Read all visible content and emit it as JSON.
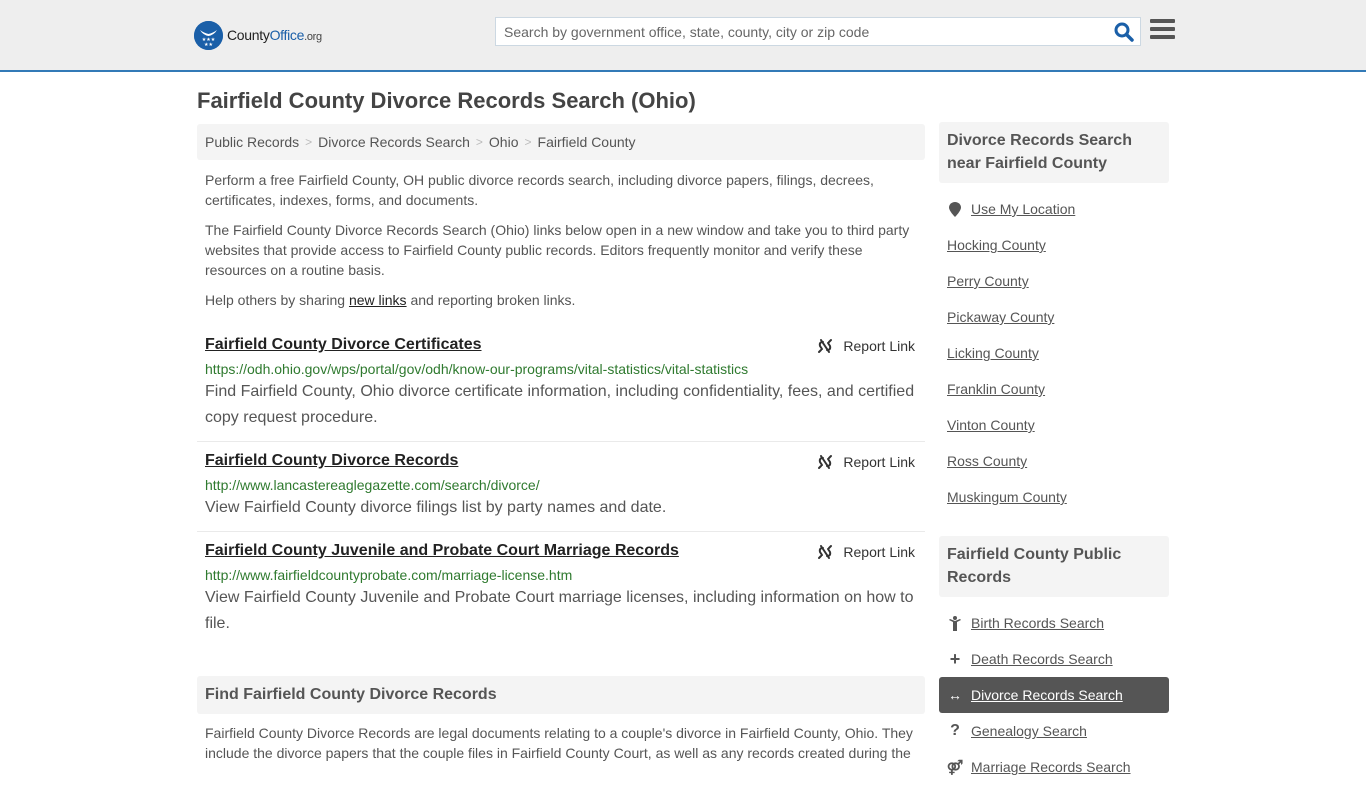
{
  "header": {
    "logo": {
      "name_part1": "County",
      "name_part2": "Office",
      "tld": ".org",
      "emblem": "eagle-stars-emblem"
    },
    "search": {
      "placeholder": "Search by government office, state, county, city or zip code",
      "value": "",
      "icon": "search-icon"
    },
    "menu_icon": "hamburger-menu-icon",
    "accent_color": "#337ab7"
  },
  "page": {
    "title": "Fairfield County Divorce Records Search (Ohio)"
  },
  "breadcrumb": [
    "Public Records",
    "Divorce Records Search",
    "Ohio",
    "Fairfield County"
  ],
  "intro": {
    "p1": "Perform a free Fairfield County, OH public divorce records search, including divorce papers, filings, decrees, certificates, indexes, forms, and documents.",
    "p2": "The Fairfield County Divorce Records Search (Ohio) links below open in a new window and take you to third party websites that provide access to Fairfield County public records. Editors frequently monitor and verify these resources on a routine basis.",
    "p3_before": "Help others by sharing ",
    "p3_link": "new links",
    "p3_after": " and reporting broken links."
  },
  "results": [
    {
      "title": "Fairfield County Divorce Certificates",
      "url": "https://odh.ohio.gov/wps/portal/gov/odh/know-our-programs/vital-statistics/vital-statistics",
      "description": "Find Fairfield County, Ohio divorce certificate information, including confidentiality, fees, and certified copy request procedure.",
      "report_label": "Report Link"
    },
    {
      "title": "Fairfield County Divorce Records",
      "url": "http://www.lancastereaglegazette.com/search/divorce/",
      "description": "View Fairfield County divorce filings list by party names and date.",
      "report_label": "Report Link"
    },
    {
      "title": "Fairfield County Juvenile and Probate Court Marriage Records",
      "url": "http://www.fairfieldcountyprobate.com/marriage-license.htm",
      "description": "View Fairfield County Juvenile and Probate Court marriage licenses, including information on how to file.",
      "report_label": "Report Link"
    }
  ],
  "find_section": {
    "heading": "Find Fairfield County Divorce Records",
    "text": "Fairfield County Divorce Records are legal documents relating to a couple's divorce in Fairfield County, Ohio. They include the divorce papers that the couple files in Fairfield County Court, as well as any records created during the"
  },
  "sidebar": {
    "nearby": {
      "heading": "Divorce Records Search near Fairfield County",
      "use_location": "Use My Location",
      "counties": [
        "Hocking County",
        "Perry County",
        "Pickaway County",
        "Licking County",
        "Franklin County",
        "Vinton County",
        "Ross County",
        "Muskingum County"
      ]
    },
    "public_records": {
      "heading": "Fairfield County Public Records",
      "items": [
        {
          "label": "Birth Records Search",
          "icon": "child-icon",
          "active": false
        },
        {
          "label": "Death Records Search",
          "icon": "plus-icon",
          "active": false
        },
        {
          "label": "Divorce Records Search",
          "icon": "double-arrow-icon",
          "active": true
        },
        {
          "label": "Genealogy Search",
          "icon": "question-icon",
          "active": false
        },
        {
          "label": "Marriage Records Search",
          "icon": "marriage-icon",
          "active": false
        }
      ]
    }
  }
}
